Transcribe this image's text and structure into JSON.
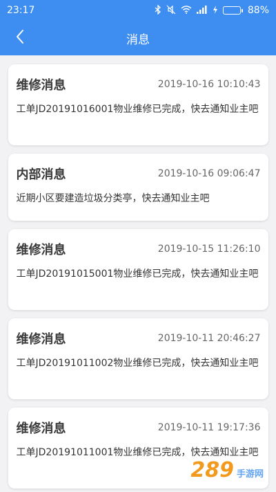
{
  "status_bar": {
    "time": "23:17",
    "battery": "88%",
    "battery_level": 0.88
  },
  "header": {
    "title": "消息"
  },
  "messages": [
    {
      "title": "维修消息",
      "time": "2019-10-16 10:10:43",
      "body": "工单JD20191016001物业维修已完成，快去通知业主吧"
    },
    {
      "title": "内部消息",
      "time": "2019-10-16 09:06:47",
      "body": "近期小区要建造垃圾分类亭，快去通知业主吧"
    },
    {
      "title": "维修消息",
      "time": "2019-10-15 11:26:10",
      "body": "工单JD20191015001物业维修已完成，快去通知业主吧"
    },
    {
      "title": "维修消息",
      "time": "2019-10-11 20:46:27",
      "body": "工单JD20191011002物业维修已完成，快去通知业主吧"
    },
    {
      "title": "维修消息",
      "time": "2019-10-11 19:17:36",
      "body": "工单JD20191011001物业维修已完成，快去通知业主吧"
    }
  ],
  "watermark": {
    "number": "289",
    "text": "手游网"
  }
}
